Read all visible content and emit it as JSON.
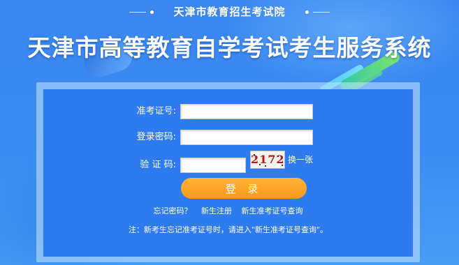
{
  "header": {
    "subtitle": "天津市教育招生考试院",
    "title": "天津市高等教育自学考试考生服务系统"
  },
  "form": {
    "exam_id_label": "准考证号:",
    "exam_id_value": "",
    "password_label": "登录密码:",
    "password_value": "",
    "captcha_label": "验 证 码:",
    "captcha_value": "",
    "captcha_image_text": "2172",
    "refresh_captcha_label": "换一张",
    "login_button_label": "登 录"
  },
  "links": {
    "forgot_password": "忘记密码？",
    "new_register": "新生注册",
    "new_exam_id_query": "新生准考证号查询"
  },
  "note": "注：新考生忘记准考证号时，请进入\"新生准考证号查询\"。",
  "colors": {
    "background": "#3b86f0",
    "panel": "#2e7bf0",
    "login_button": "#f69a1c",
    "captcha_text": "#b51818"
  }
}
